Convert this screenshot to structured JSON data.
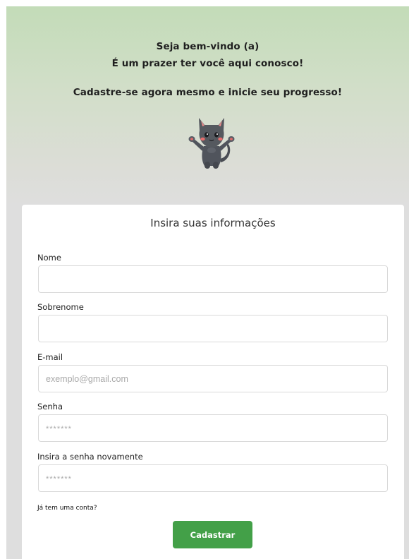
{
  "hero": {
    "line1": "Seja bem-vindo (a)",
    "line2": "É um prazer ter você aqui conosco!",
    "line3": "Cadastre-se agora mesmo e inicie seu progresso!",
    "mascot_icon": "cat-mascot-icon"
  },
  "form": {
    "title": "Insira suas informações",
    "fields": [
      {
        "label": "Nome",
        "value": "",
        "placeholder": ""
      },
      {
        "label": "Sobrenome",
        "value": "",
        "placeholder": ""
      },
      {
        "label": "E-mail",
        "value": "",
        "placeholder": "exemplo@gmail.com"
      },
      {
        "label": "Senha",
        "value": "",
        "placeholder": "*******"
      },
      {
        "label": "Insira a senha novamente",
        "value": "",
        "placeholder": "*******"
      }
    ],
    "login_link": "Já tem uma conta?",
    "submit_label": "Cadastrar"
  },
  "colors": {
    "gradient_top": "#c3dcb8",
    "gradient_bottom": "#dedede",
    "button": "#43a048",
    "button_text": "#ffffff"
  }
}
